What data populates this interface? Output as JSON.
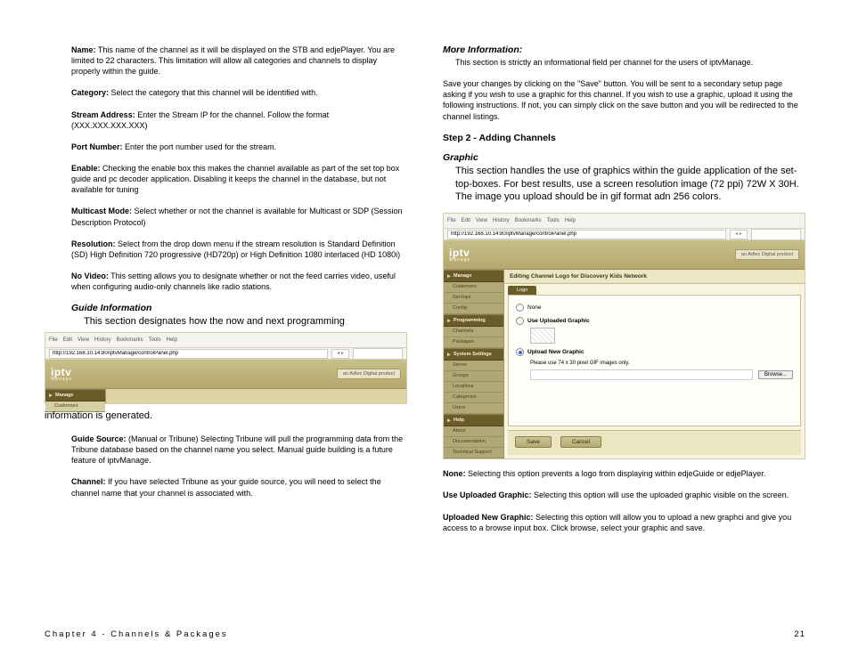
{
  "left": {
    "name_label": "Name:",
    "name_text": "  This name of the channel as it will be displayed on the STB and edjePlayer.  You are limited to 22 characters. This limitation will allow all categories and channels to display properly within the guide.",
    "category_label": "Category:",
    "category_text": " Select the category that this channel will be identified with.",
    "stream_label": "Stream Address:",
    "stream_text": " Enter the Stream IP for the channel. Follow the format (XXX.XXX.XXX.XXX)",
    "port_label": "Port Number:",
    "port_text": " Enter the port number used for the stream.",
    "enable_label": "Enable:",
    "enable_text": " Checking the enable box this makes the channel available as part of the set top box guide and pc decoder application.  Disabling it keeps the channel in the database, but not available for tuning",
    "multicast_label": "Multicast Mode:",
    "multicast_text": " Select whether or not the channel is available for Multicast or SDP (Session Description Protocol)",
    "resolution_label": "Resolution:",
    "resolution_text": " Select from the drop down menu if the stream resolution is Standard Definition (SD) High Definition 720 progressive (HD720p) or High Definition 1080 interlaced (HD 1080i)",
    "novideo_label": "No Video:",
    "novideo_text": " This setting allows you to designate whether or not the feed carries video, useful when configuring audio-only channels like radio stations.",
    "guide_heading": "Guide Information",
    "guide_line": "This section designates how the now and next programming",
    "info_generated": "information is generated.",
    "guidesrc_label": "Guide Source:",
    "guidesrc_text": "  (Manual or Tribune) Selecting Tribune will pull the programming data from the Tribune database based on the channel name you select.  Manual guide building is a future feature of iptvManage.",
    "channel_label": "Channel:",
    "channel_text": "  If you have selected Tribune as your guide source, you will need to select the channel name that your channel is associated with."
  },
  "right": {
    "more_heading": "More Information:",
    "more_text": "This section is strictly an informational field per channel for the users of iptvManage.",
    "save_para": "Save your changes by clicking on the \"Save\" button. You will be sent to a secondary setup page asking if you wish to use a graphic for this channel.  If you wish to use a graphic, upload it using the following instructions. If not, you can simply click on the save button and you will be redirected to the channel listings.",
    "step2_heading": "Step 2 - Adding Channels",
    "graphic_heading": "Graphic",
    "graphic_para": "This section handles the use of graphics within the guide application of the set-top-boxes.  For best results, use a screen resolution image (72 ppi) 72W X 30H. The image you upload should be in gif format adn 256 colors.",
    "none_label": "None:",
    "none_text": " Selecting this option prevents a logo from displaying within edjeGuide or edjePlayer.",
    "useup_label": "Use Uploaded Graphic:",
    "useup_text": " Selecting this option will use the uploaded graphic visible on the screen.",
    "upnew_label": "Uploaded New Graphic:",
    "upnew_text": " Selecting this option will allow you to upload a new graphci and give you access to a browse input box. Click browse, select your graphic and save."
  },
  "browser": {
    "menu": {
      "file": "File",
      "edit": "Edit",
      "view": "View",
      "history": "History",
      "bookmarks": "Bookmarks",
      "tools": "Tools",
      "help": "Help"
    },
    "url": "http://192.168.10.14:80/iptvManage/controlPanel.php",
    "nav": "◂ ▸",
    "adtec": "an Adtec Digital product",
    "logo": "iptv",
    "logo_sub": "Manage"
  },
  "sidebar": {
    "manage": "Manage",
    "customers": "Customers",
    "set_tops": "Set-tops",
    "config": "Config",
    "programming": "Programming",
    "channels": "Channels",
    "packages": "Packages",
    "system": "System Settings",
    "server": "Server",
    "groups": "Groups",
    "locations": "Locations",
    "categories": "Categories",
    "users": "Users",
    "help": "Help",
    "about": "About",
    "documentation": "Documentation",
    "tech": "Technical Support"
  },
  "panel": {
    "title": "Editing Channel Logo for Discovery Kids Network",
    "tab": "Logo",
    "radio_none": "None",
    "radio_use": "Use Uploaded Graphic",
    "radio_upload": "Upload New Graphic",
    "hint": "Please use 74 x 30 pixel GIF images only.",
    "browse": "Browse...",
    "save": "Save",
    "cancel": "Cancel"
  },
  "footer": {
    "chapter": "Chapter 4 - Channels & Packages",
    "page": "21"
  }
}
